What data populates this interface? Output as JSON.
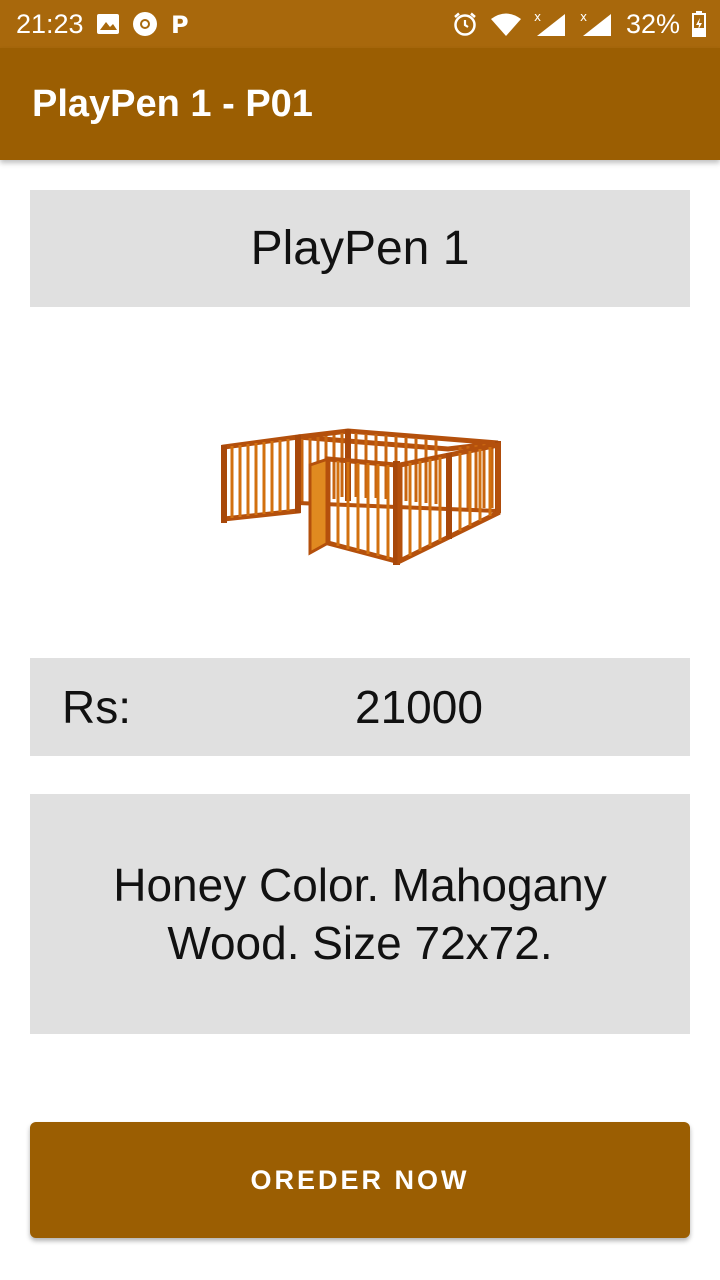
{
  "status_bar": {
    "time": "21:23",
    "battery": "32%",
    "background_color": "#a8680c",
    "left_icons": [
      "image-icon",
      "chrome-icon",
      "p-icon"
    ],
    "right_icons": [
      "alarm-icon",
      "wifi-icon",
      "signal-icon",
      "signal-icon",
      "battery-icon"
    ]
  },
  "app_bar": {
    "title": "PlayPen 1 - P01",
    "background_color": "#9b5e02"
  },
  "product": {
    "name": "PlayPen 1",
    "image_icon": "playpen-image",
    "price_label": "Rs:",
    "price_value": "21000",
    "description": "Honey Color. Mahogany Wood. Size 72x72."
  },
  "actions": {
    "order_label": "OREDER NOW",
    "accent_color": "#9b5e02"
  }
}
